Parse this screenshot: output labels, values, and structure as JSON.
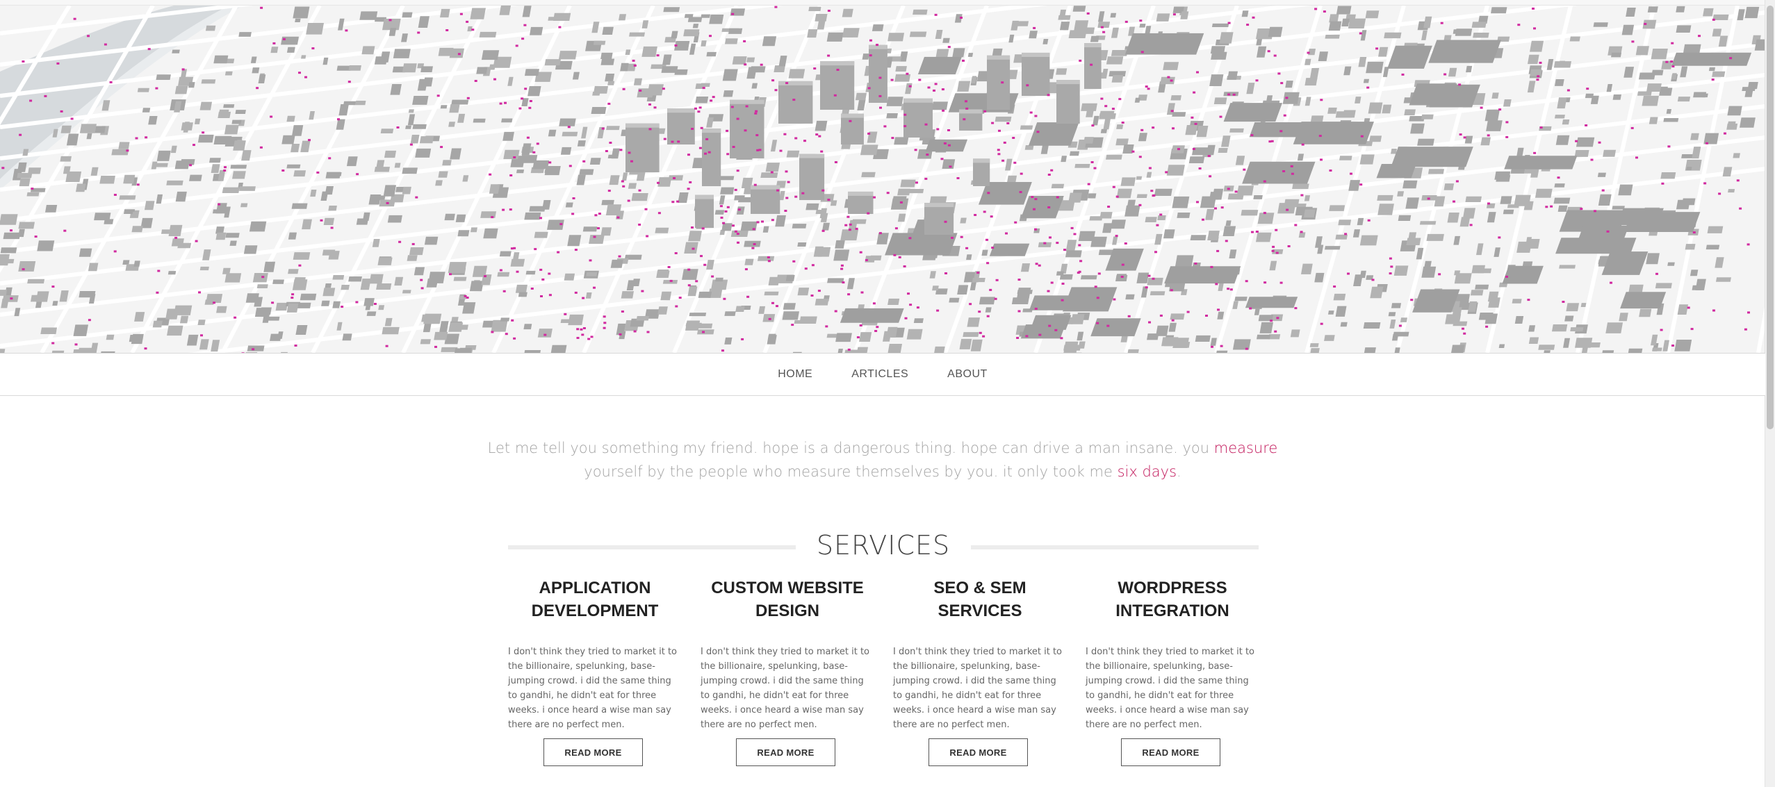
{
  "nav": {
    "items": [
      {
        "label": "HOME"
      },
      {
        "label": "ARTICLES"
      },
      {
        "label": "ABOUT"
      }
    ]
  },
  "quote": {
    "part1": "Let me tell you something my friend. hope is a dangerous thing. hope can drive a man insane. you ",
    "link1": "measure",
    "part2": " yourself by the people who measure themselves by you. it only took me ",
    "link2": "six days",
    "part3": "."
  },
  "services": {
    "heading": "SERVICES",
    "items": [
      {
        "title_line1": "APPLICATION",
        "title_line2": "DEVELOPMENT",
        "body": "I don't think they tried to market it to the billionaire, spelunking, base-jumping crowd. i did the same thing to gandhi, he didn't eat for three weeks. i once heard a wise man say there are no perfect men.",
        "button": "READ MORE"
      },
      {
        "title_line1": "CUSTOM WEBSITE",
        "title_line2": "DESIGN",
        "body": "I don't think they tried to market it to the billionaire, spelunking, base-jumping crowd. i did the same thing to gandhi, he didn't eat for three weeks. i once heard a wise man say there are no perfect men.",
        "button": "READ MORE"
      },
      {
        "title_line1": "SEO & SEM",
        "title_line2": "SERVICES",
        "body": "I don't think they tried to market it to the billionaire, spelunking, base-jumping crowd. i did the same thing to gandhi, he didn't eat for three weeks. i once heard a wise man say there are no perfect men.",
        "button": "READ MORE"
      },
      {
        "title_line1": "WORDPRESS",
        "title_line2": "INTEGRATION",
        "body": "I don't think they tried to market it to the billionaire, spelunking, base-jumping crowd. i did the same thing to gandhi, he didn't eat for three weeks. i once heard a wise man say there are no perfect men.",
        "button": "READ MORE"
      }
    ]
  },
  "colors": {
    "accent": "#c2185b",
    "map_building": "#a6a6a6",
    "map_background": "#f3f3f3",
    "map_dots": "#d12aa0",
    "river": "#d5d9dc"
  },
  "hero": {
    "image": "3d-city-map-icon"
  }
}
